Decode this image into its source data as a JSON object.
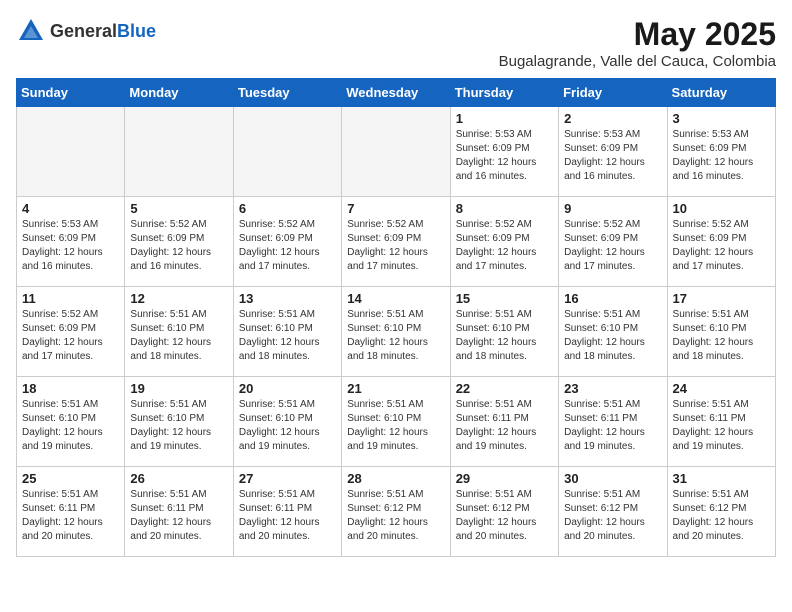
{
  "logo": {
    "text_general": "General",
    "text_blue": "Blue"
  },
  "title": {
    "month_year": "May 2025",
    "location": "Bugalagrande, Valle del Cauca, Colombia"
  },
  "days_of_week": [
    "Sunday",
    "Monday",
    "Tuesday",
    "Wednesday",
    "Thursday",
    "Friday",
    "Saturday"
  ],
  "weeks": [
    [
      {
        "day": "",
        "info": ""
      },
      {
        "day": "",
        "info": ""
      },
      {
        "day": "",
        "info": ""
      },
      {
        "day": "",
        "info": ""
      },
      {
        "day": "1",
        "info": "Sunrise: 5:53 AM\nSunset: 6:09 PM\nDaylight: 12 hours\nand 16 minutes."
      },
      {
        "day": "2",
        "info": "Sunrise: 5:53 AM\nSunset: 6:09 PM\nDaylight: 12 hours\nand 16 minutes."
      },
      {
        "day": "3",
        "info": "Sunrise: 5:53 AM\nSunset: 6:09 PM\nDaylight: 12 hours\nand 16 minutes."
      }
    ],
    [
      {
        "day": "4",
        "info": "Sunrise: 5:53 AM\nSunset: 6:09 PM\nDaylight: 12 hours\nand 16 minutes."
      },
      {
        "day": "5",
        "info": "Sunrise: 5:52 AM\nSunset: 6:09 PM\nDaylight: 12 hours\nand 16 minutes."
      },
      {
        "day": "6",
        "info": "Sunrise: 5:52 AM\nSunset: 6:09 PM\nDaylight: 12 hours\nand 17 minutes."
      },
      {
        "day": "7",
        "info": "Sunrise: 5:52 AM\nSunset: 6:09 PM\nDaylight: 12 hours\nand 17 minutes."
      },
      {
        "day": "8",
        "info": "Sunrise: 5:52 AM\nSunset: 6:09 PM\nDaylight: 12 hours\nand 17 minutes."
      },
      {
        "day": "9",
        "info": "Sunrise: 5:52 AM\nSunset: 6:09 PM\nDaylight: 12 hours\nand 17 minutes."
      },
      {
        "day": "10",
        "info": "Sunrise: 5:52 AM\nSunset: 6:09 PM\nDaylight: 12 hours\nand 17 minutes."
      }
    ],
    [
      {
        "day": "11",
        "info": "Sunrise: 5:52 AM\nSunset: 6:09 PM\nDaylight: 12 hours\nand 17 minutes."
      },
      {
        "day": "12",
        "info": "Sunrise: 5:51 AM\nSunset: 6:10 PM\nDaylight: 12 hours\nand 18 minutes."
      },
      {
        "day": "13",
        "info": "Sunrise: 5:51 AM\nSunset: 6:10 PM\nDaylight: 12 hours\nand 18 minutes."
      },
      {
        "day": "14",
        "info": "Sunrise: 5:51 AM\nSunset: 6:10 PM\nDaylight: 12 hours\nand 18 minutes."
      },
      {
        "day": "15",
        "info": "Sunrise: 5:51 AM\nSunset: 6:10 PM\nDaylight: 12 hours\nand 18 minutes."
      },
      {
        "day": "16",
        "info": "Sunrise: 5:51 AM\nSunset: 6:10 PM\nDaylight: 12 hours\nand 18 minutes."
      },
      {
        "day": "17",
        "info": "Sunrise: 5:51 AM\nSunset: 6:10 PM\nDaylight: 12 hours\nand 18 minutes."
      }
    ],
    [
      {
        "day": "18",
        "info": "Sunrise: 5:51 AM\nSunset: 6:10 PM\nDaylight: 12 hours\nand 19 minutes."
      },
      {
        "day": "19",
        "info": "Sunrise: 5:51 AM\nSunset: 6:10 PM\nDaylight: 12 hours\nand 19 minutes."
      },
      {
        "day": "20",
        "info": "Sunrise: 5:51 AM\nSunset: 6:10 PM\nDaylight: 12 hours\nand 19 minutes."
      },
      {
        "day": "21",
        "info": "Sunrise: 5:51 AM\nSunset: 6:10 PM\nDaylight: 12 hours\nand 19 minutes."
      },
      {
        "day": "22",
        "info": "Sunrise: 5:51 AM\nSunset: 6:11 PM\nDaylight: 12 hours\nand 19 minutes."
      },
      {
        "day": "23",
        "info": "Sunrise: 5:51 AM\nSunset: 6:11 PM\nDaylight: 12 hours\nand 19 minutes."
      },
      {
        "day": "24",
        "info": "Sunrise: 5:51 AM\nSunset: 6:11 PM\nDaylight: 12 hours\nand 19 minutes."
      }
    ],
    [
      {
        "day": "25",
        "info": "Sunrise: 5:51 AM\nSunset: 6:11 PM\nDaylight: 12 hours\nand 20 minutes."
      },
      {
        "day": "26",
        "info": "Sunrise: 5:51 AM\nSunset: 6:11 PM\nDaylight: 12 hours\nand 20 minutes."
      },
      {
        "day": "27",
        "info": "Sunrise: 5:51 AM\nSunset: 6:11 PM\nDaylight: 12 hours\nand 20 minutes."
      },
      {
        "day": "28",
        "info": "Sunrise: 5:51 AM\nSunset: 6:12 PM\nDaylight: 12 hours\nand 20 minutes."
      },
      {
        "day": "29",
        "info": "Sunrise: 5:51 AM\nSunset: 6:12 PM\nDaylight: 12 hours\nand 20 minutes."
      },
      {
        "day": "30",
        "info": "Sunrise: 5:51 AM\nSunset: 6:12 PM\nDaylight: 12 hours\nand 20 minutes."
      },
      {
        "day": "31",
        "info": "Sunrise: 5:51 AM\nSunset: 6:12 PM\nDaylight: 12 hours\nand 20 minutes."
      }
    ]
  ]
}
